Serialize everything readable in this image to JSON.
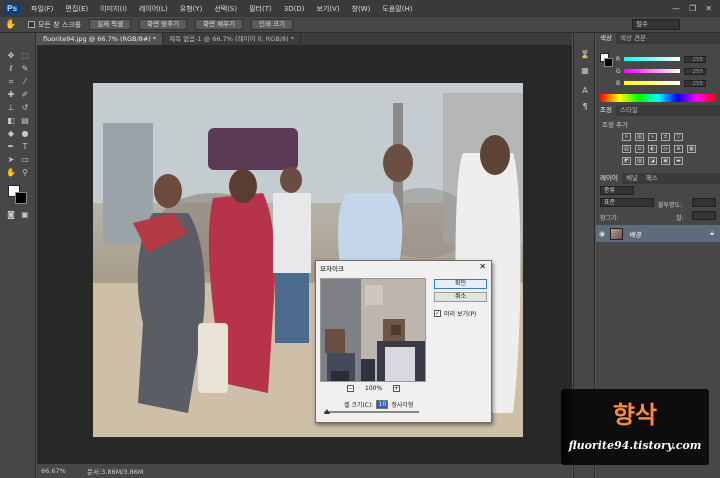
{
  "menubar": {
    "logo": "Ps",
    "items": [
      "파일(F)",
      "편집(E)",
      "이미지(I)",
      "레이어(L)",
      "유형(Y)",
      "선택(S)",
      "필터(T)",
      "3D(D)",
      "보기(V)",
      "창(W)",
      "도움말(H)"
    ],
    "window_controls": [
      "—",
      "❐",
      "✕"
    ]
  },
  "options_bar": {
    "tool_icon": "hand-icon",
    "all_windows_scroll": "모든 창 스크롤",
    "buttons": [
      "실제 픽셀",
      "화면 맞추기",
      "화면 채우기",
      "인쇄 크기"
    ],
    "workspace": "필수"
  },
  "tabs": [
    {
      "label": "fluorite94.jpg @ 66.7% (RGB/8#) *",
      "active": true
    },
    {
      "label": "제목 없음-1 @ 66.7% (레이어 0, RGB/8) *",
      "active": false
    }
  ],
  "status": {
    "zoom": "66.67%",
    "doc": "문서:3.86M/3.86M"
  },
  "color_panel": {
    "tabs": [
      "색상",
      "색상 견본"
    ],
    "sliders": [
      {
        "label": "R",
        "value": "255",
        "gradient": "linear-gradient(90deg,#0ff,#fff)"
      },
      {
        "label": "G",
        "value": "255",
        "gradient": "linear-gradient(90deg,#f0f,#fff)"
      },
      {
        "label": "B",
        "value": "255",
        "gradient": "linear-gradient(90deg,#ff0,#fff)"
      }
    ]
  },
  "adjust_panel": {
    "tabs": [
      "조정",
      "스타일"
    ],
    "add_label": "조정 추가"
  },
  "layers_panel": {
    "tabs": [
      "레이어",
      "채널",
      "패스"
    ],
    "filter": "종류",
    "blend_mode": "표준",
    "opacity_label": "불투명도:",
    "lock_label": "잠그기:",
    "fill_label": "칠:",
    "layer_name": "배경"
  },
  "dialog": {
    "title": "모자이크",
    "ok": "확인",
    "cancel": "취소",
    "preview": "미리 보기(P)",
    "zoom_percent": "100%",
    "cell_size_label": "셀 크기(C):",
    "cell_size_value": "10",
    "unit": "정사각형"
  },
  "watermark": {
    "title": "향삭",
    "url": "fluorite94.tistory.com"
  }
}
